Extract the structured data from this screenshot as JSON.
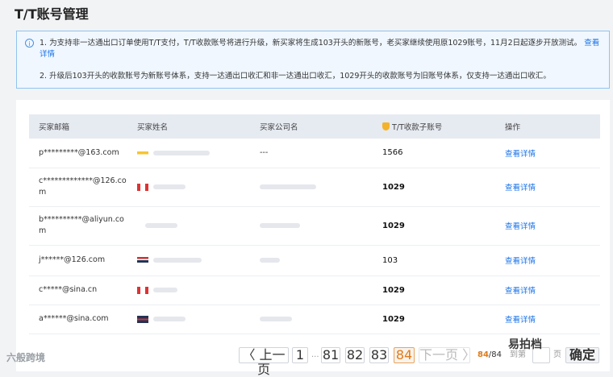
{
  "page": {
    "title": "T/T账号管理"
  },
  "notice": {
    "icon": "info-icon",
    "p1_text": "1. 为支持非一达通出口订单使用T/T支付，T/T收款账号将进行升级，新买家将生成103开头的新账号，老买家继续使用原1029账号，11月2日起逐步开放测试。",
    "p1_link": "查看详情",
    "p2_text": "2. 升级后103开头的收款账号为新账号体系，支持一达通出口收汇和非一达通出口收汇，1029开头的收款账号为旧账号体系，仅支持一达通出口收汇。"
  },
  "table": {
    "headers": [
      "买家邮箱",
      "买家姓名",
      "买家公司名",
      "T/T收款子账号",
      "操作"
    ],
    "header_icon": "medal-icon",
    "rows": [
      {
        "email": "p*********@163.com",
        "name_flag": "yellow",
        "company": "---",
        "account": "1566",
        "bold": false,
        "action": "查看详情"
      },
      {
        "email": "c*************@126.com",
        "name_flag": "red",
        "company": "",
        "account": "1029",
        "bold": true,
        "action": "查看详情"
      },
      {
        "email": "b**********@aliyun.com",
        "name_flag": "",
        "company": "",
        "account": "1029",
        "bold": true,
        "action": "查看详情"
      },
      {
        "email": "j******@126.com",
        "name_flag": "us",
        "company": "",
        "account": "103",
        "bold": false,
        "action": "查看详情"
      },
      {
        "email": "c*****@sina.cn",
        "name_flag": "red",
        "company": "",
        "account": "1029",
        "bold": true,
        "action": "查看详情"
      },
      {
        "email": "a******@sina.com",
        "name_flag": "uk",
        "company": "",
        "account": "1029",
        "bold": true,
        "action": "查看详情"
      }
    ]
  },
  "pagination": {
    "prev": "〈 上一页",
    "pages": [
      "1",
      "81",
      "82",
      "83",
      "84"
    ],
    "ellipsis": "...",
    "current": "84",
    "next": "下一页 〉",
    "count_current": "84",
    "count_total": "/84",
    "goto_label": "到第",
    "page_suffix": "页",
    "confirm": "确定"
  },
  "watermarks": {
    "left": "六般跨境",
    "right": "易拍档"
  },
  "colors": {
    "accent": "#e07b19",
    "link": "#1a73e8",
    "header_bg": "#e6eaf1"
  }
}
